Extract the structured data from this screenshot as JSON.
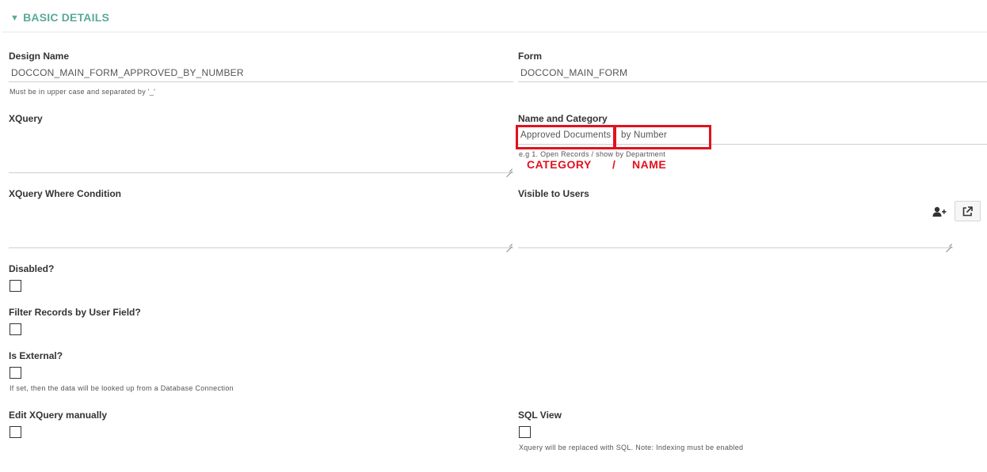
{
  "section": {
    "title": "BASIC DETAILS",
    "caret": "▼"
  },
  "design_name": {
    "label": "Design Name",
    "value": "DOCCON_MAIN_FORM_APPROVED_BY_NUMBER",
    "help": "Must be in upper case and separated by '_'"
  },
  "form": {
    "label": "Form",
    "value": "DOCCON_MAIN_FORM"
  },
  "xquery": {
    "label": "XQuery"
  },
  "name_category": {
    "label": "Name and Category",
    "category_value": "Approved Documents",
    "name_value": "by Number",
    "help": "e.g 1. Open Records / show by Department"
  },
  "annotation": {
    "category": "CATEGORY",
    "slash": "/",
    "name": "NAME"
  },
  "xquery_where": {
    "label": "XQuery Where Condition"
  },
  "visible_users": {
    "label": "Visible to Users"
  },
  "disabled": {
    "label": "Disabled?"
  },
  "filter_records": {
    "label": "Filter Records by User Field?"
  },
  "is_external": {
    "label": "Is External?",
    "help": "If set, then the data will be looked up from a Database Connection"
  },
  "edit_xquery": {
    "label": "Edit XQuery manually"
  },
  "sql_view": {
    "label": "SQL View",
    "help": "Xquery will be replaced with SQL. Note: Indexing must be enabled"
  },
  "colors": {
    "accent": "#5aa99a",
    "annotation_red": "#e0121f"
  },
  "icons": {
    "add_user": "user-plus-icon",
    "open_external": "external-link-icon"
  }
}
